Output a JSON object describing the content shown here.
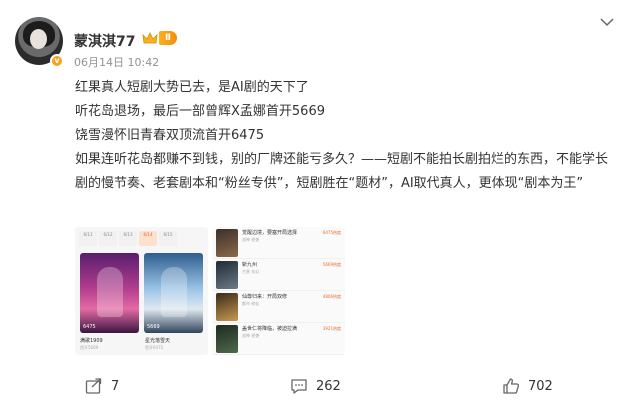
{
  "post": {
    "author": "蒙淇淇77",
    "level": "Ⅱ",
    "verified_mark": "v",
    "time": "06月14日 10:42",
    "lines": [
      "红果真人短剧大势已去，是AI剧的天下了",
      "听花岛退场，最后一部曾辉X孟娜首开5669",
      "饶雪漫怀旧青春双顶流首开6475",
      "如果连听花岛都赚不到钱，别的厂牌还能亏多久？——短剧不能拍长剧拍烂的东西，不能学长剧的慢节奏、老套剧本和“粉丝专供”，短剧胜在“题材”，AI取代真人，更体现“剧本为王”"
    ]
  },
  "thumb1": {
    "dates": [
      "6/11",
      "6/12",
      "6/13",
      "6/14",
      "6/15"
    ],
    "active_date_index": 3,
    "cards": [
      {
        "title": "满歌1909",
        "sub": "首开5669",
        "caption": "6475"
      },
      {
        "title": "星光落雪天",
        "sub": "首开6475",
        "caption": "5669"
      }
    ]
  },
  "thumb2": {
    "rows": [
      {
        "title": "觉醒边境，要塞开局选择",
        "meta": "战神 逆袭",
        "heat": "6475热度"
      },
      {
        "title": "斩九州",
        "meta": "古装 玄幻",
        "heat": "5669热度"
      },
      {
        "title": "仙尊归来：开局双修",
        "meta": "都市 修仙",
        "heat": "4806热度"
      },
      {
        "title": "盖世仁将降临，被迫拉满",
        "meta": "战神 逆袭",
        "heat": "3921热度"
      }
    ]
  },
  "actions": {
    "share_count": "7",
    "comment_count": "262",
    "like_count": "702"
  },
  "colors": {
    "accent": "#f7a21b",
    "heat": "#f06a2a"
  },
  "icons": [
    "crown-icon",
    "chevron-down-icon",
    "share-icon",
    "comment-icon",
    "like-icon"
  ]
}
